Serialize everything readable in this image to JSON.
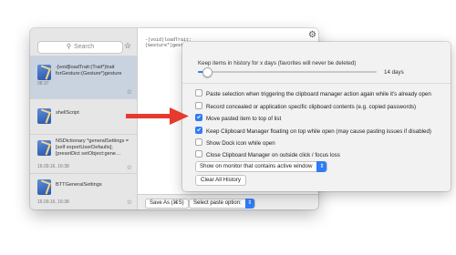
{
  "sidebar": {
    "search_placeholder": "Search",
    "clips": [
      {
        "text": "-[void]loadTrait:(Trait*)trait forGesture:(Gesture*)gesture",
        "time": "08:37"
      },
      {
        "text": "shellScript",
        "time": ""
      },
      {
        "text": "NSDictionary *generalSettings = [self exportUserDefaults]; [presetDict setObject:gene…",
        "time": "16.09.16, 16:38"
      },
      {
        "text": "BTTGeneralSettings",
        "time": "16.09.16, 16:38"
      }
    ]
  },
  "preview": {
    "code_line1": "-(void)loadTrait:",
    "code_line2": "(Gesture*)gestur"
  },
  "bottombar": {
    "save_label": "Save As (⌘S)",
    "paste_option_label": "Select paste option:"
  },
  "settings": {
    "keep_label": "Keep items in history for x days (favorites will never be deleted)",
    "days_value": "14 days",
    "slider_fraction": 0.05,
    "options": [
      {
        "label": "Paste selection when triggering the clipboard manager action again while it's already open",
        "checked": false
      },
      {
        "label": "Record concealed or application specific clipboard contents (e.g. copied passwords)",
        "checked": false
      },
      {
        "label": "Move pasted item to top of list",
        "checked": true
      },
      {
        "label": "Keep Clipboard Manager floating on top while open (may cause pasting issues if disabled)",
        "checked": true
      },
      {
        "label": "Show Dock icon while open",
        "checked": false
      },
      {
        "label": "Close Clipboard Manager on outside click / focus loss",
        "checked": false
      }
    ],
    "monitor_select": "Show on monitor that contains active window",
    "clear_label": "Clear All History"
  },
  "colors": {
    "accent": "#2f7cf6",
    "arrow": "#e63a2e",
    "selected_row": "#c9d3e0"
  }
}
